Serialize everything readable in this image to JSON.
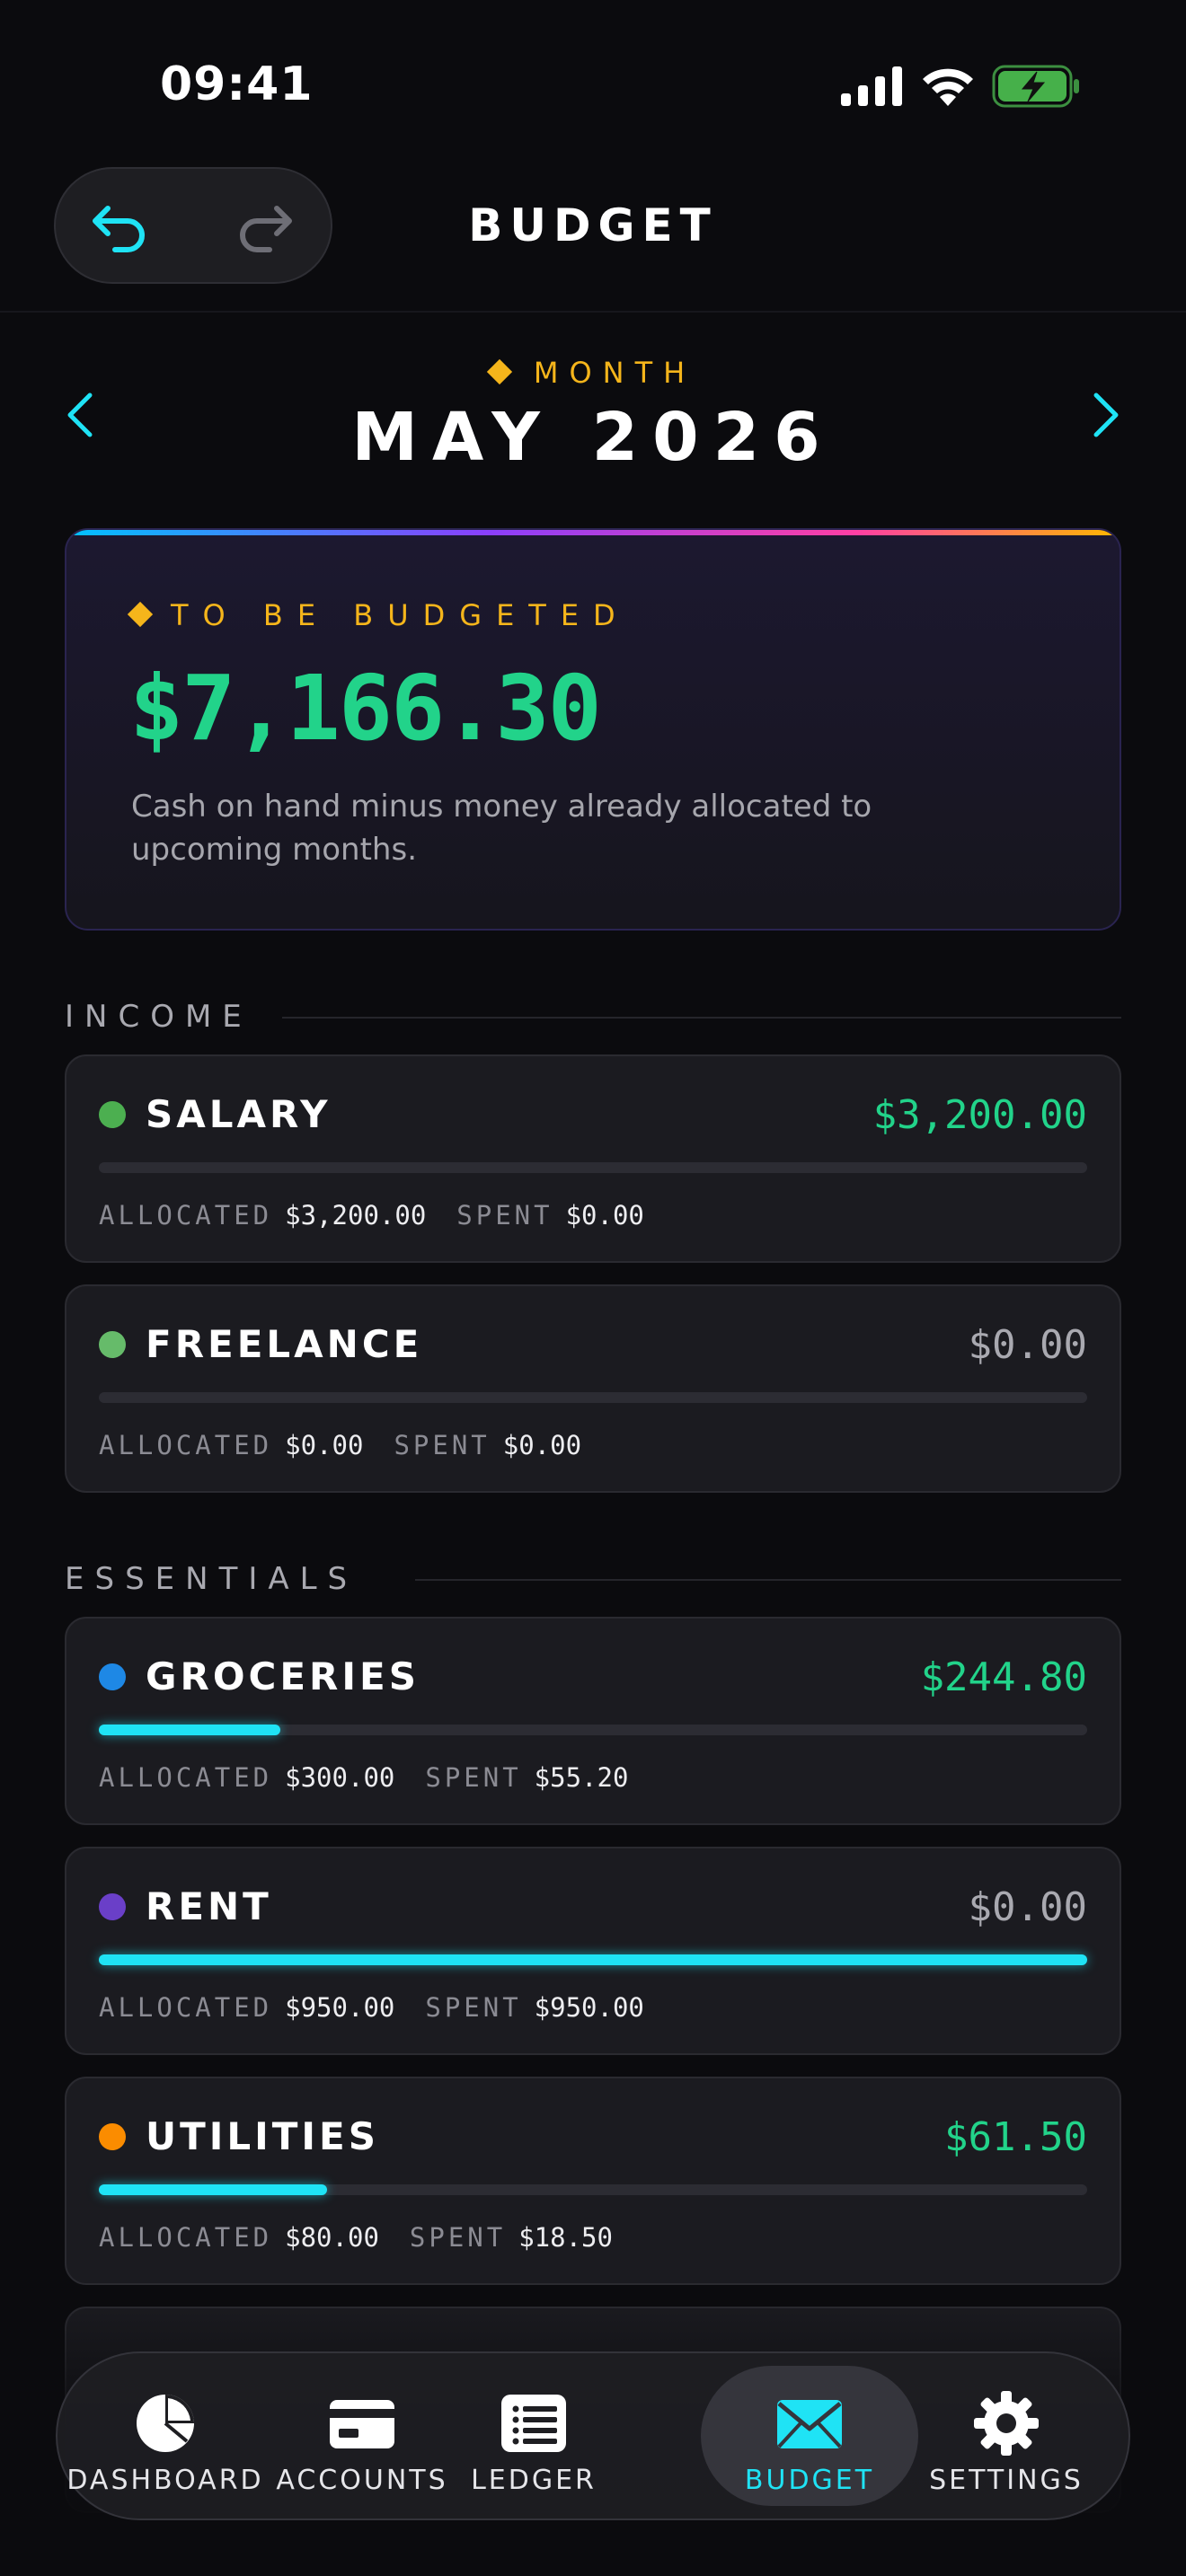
{
  "status_bar": {
    "time": "09:41"
  },
  "header": {
    "title": "BUDGET"
  },
  "month_picker": {
    "label": "MONTH",
    "value": "MAY 2026"
  },
  "to_be_budgeted": {
    "label": "TO BE BUDGETED",
    "amount": "$7,166.30",
    "description": "Cash on hand minus money already allocated to upcoming months."
  },
  "meta_labels": {
    "allocated": "ALLOCATED",
    "spent": "SPENT"
  },
  "sections": {
    "income": {
      "title": "INCOME",
      "categories": [
        {
          "name": "SALARY",
          "available": "$3,200.00",
          "allocated": "$3,200.00",
          "spent": "$0.00",
          "dot_color": "#4caf50",
          "amount_color": "#22d38a",
          "spent_fraction": 0.0
        },
        {
          "name": "FREELANCE",
          "available": "$0.00",
          "allocated": "$0.00",
          "spent": "$0.00",
          "dot_color": "#66bb6a",
          "amount_color": "#a9a9b0",
          "spent_fraction": 0.0
        }
      ]
    },
    "essentials": {
      "title": "ESSENTIALS",
      "categories": [
        {
          "name": "GROCERIES",
          "available": "$244.80",
          "allocated": "$300.00",
          "spent": "$55.20",
          "dot_color": "#1e88e5",
          "amount_color": "#22d38a",
          "spent_fraction": 0.184
        },
        {
          "name": "RENT",
          "available": "$0.00",
          "allocated": "$950.00",
          "spent": "$950.00",
          "dot_color": "#6a3fc8",
          "amount_color": "#a9a9b0",
          "spent_fraction": 1.0
        },
        {
          "name": "UTILITIES",
          "available": "$61.50",
          "allocated": "$80.00",
          "spent": "$18.50",
          "dot_color": "#fb8c00",
          "amount_color": "#22d38a",
          "spent_fraction": 0.231
        }
      ]
    }
  },
  "tab_bar": {
    "tabs": [
      {
        "label": "DASHBOARD",
        "icon": "pie-chart-icon"
      },
      {
        "label": "ACCOUNTS",
        "icon": "credit-card-icon"
      },
      {
        "label": "LEDGER",
        "icon": "list-icon"
      },
      {
        "label": "BUDGET",
        "icon": "envelope-icon",
        "active": true
      },
      {
        "label": "SETTINGS",
        "icon": "gear-icon"
      }
    ],
    "active_color": "#1fe3f5"
  },
  "colors": {
    "accent": "#1fe3f5",
    "gold": "#f5b51b",
    "positive": "#22d38a",
    "background": "#0b0b0e"
  }
}
